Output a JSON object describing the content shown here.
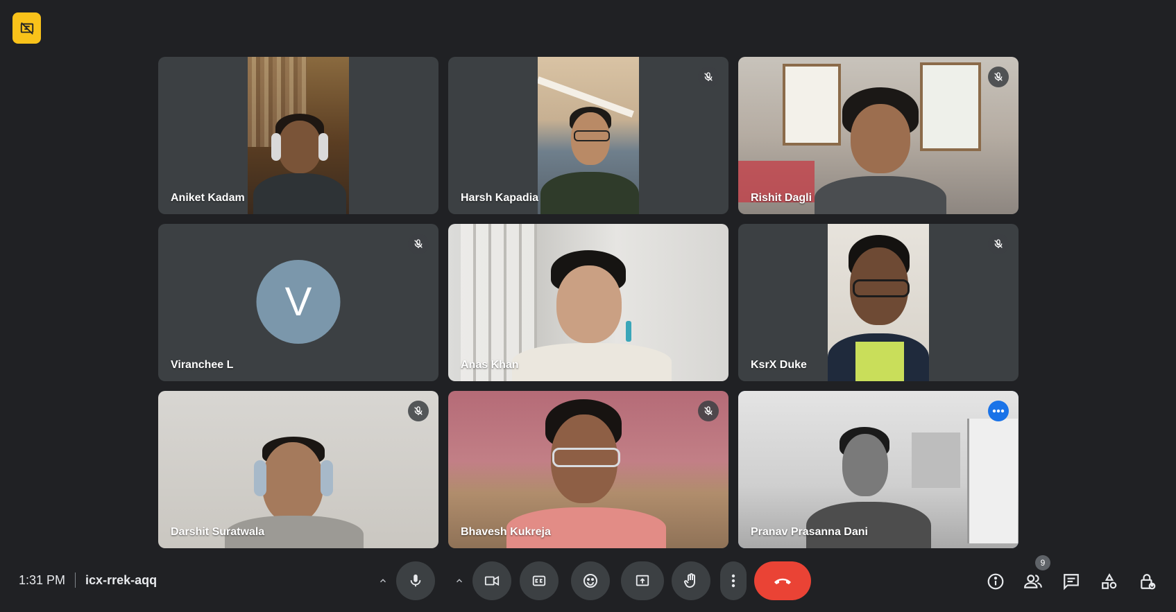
{
  "meeting": {
    "time": "1:31 PM",
    "code": "icx-rrek-aqq",
    "participant_count": "9"
  },
  "participants": [
    {
      "name": "Aniket Kadam"
    },
    {
      "name": "Harsh Kapadia"
    },
    {
      "name": "Rishit Dagli"
    },
    {
      "name": "Viranchee L",
      "avatar_letter": "V"
    },
    {
      "name": "Anas Khan"
    },
    {
      "name": "KsrX Duke"
    },
    {
      "name": "Darshit Suratwala"
    },
    {
      "name": "Bhavesh Kukreja"
    },
    {
      "name": "Pranav Prasanna Dani"
    }
  ],
  "colors": {
    "background": "#202124",
    "tile": "#3c4043",
    "end_call": "#ea4335",
    "accent": "#1a73e8",
    "badge": "#f9c21a"
  },
  "icons": [
    "no-presentation-icon",
    "mic-off-icon",
    "more-options-icon",
    "chevron-up-icon",
    "mic-icon",
    "camera-icon",
    "captions-icon",
    "emoji-icon",
    "present-icon",
    "raise-hand-icon",
    "more-vert-icon",
    "end-call-icon",
    "info-icon",
    "people-icon",
    "chat-icon",
    "activities-icon",
    "host-controls-icon"
  ]
}
